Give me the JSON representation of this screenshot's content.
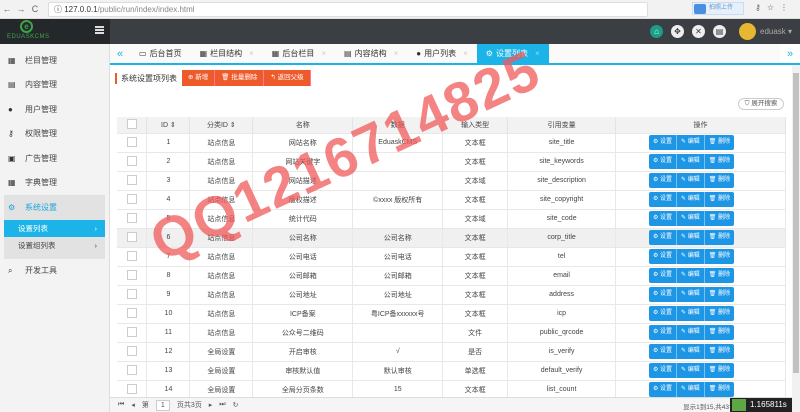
{
  "browser": {
    "url_host": "127.0.0.1",
    "url_path": "/public/run/index/index.html",
    "extension_label": "拍照上传"
  },
  "header": {
    "logo_text": "EDUASKCMS",
    "logo_mark": "e",
    "username": "eduask"
  },
  "sidebar": {
    "items": [
      {
        "label": "栏目管理",
        "icon": "▦"
      },
      {
        "label": "内容管理",
        "icon": "▤"
      },
      {
        "label": "用户管理",
        "icon": "●"
      },
      {
        "label": "权限管理",
        "icon": "⚷"
      },
      {
        "label": "广告管理",
        "icon": "▣"
      },
      {
        "label": "字典管理",
        "icon": "▦"
      }
    ],
    "group": {
      "label": "系统设置",
      "icon": "⚙",
      "subs": [
        {
          "label": "设置列表"
        },
        {
          "label": "设置组列表"
        }
      ]
    },
    "dev": {
      "label": "开发工具",
      "icon": "⌕"
    }
  },
  "tabs": [
    {
      "label": "后台首页",
      "icon": "▭"
    },
    {
      "label": "栏目结构",
      "icon": "▦"
    },
    {
      "label": "后台栏目",
      "icon": "▦"
    },
    {
      "label": "内容结构",
      "icon": "▤"
    },
    {
      "label": "用户列表",
      "icon": "●"
    },
    {
      "label": "设置列表",
      "icon": "⚙"
    }
  ],
  "toolbar": {
    "title": "系统设置项列表",
    "add": "新增",
    "batch_delete": "批量删除",
    "back": "返回父级",
    "search": "展开搜索"
  },
  "table": {
    "headers": [
      "ID",
      "分类ID",
      "名称",
      "数据",
      "输入类型",
      "引用变量",
      "操作"
    ],
    "rows": [
      [
        "1",
        "站点信息",
        "网站名称",
        "EduaskCMS",
        "文本框",
        "site_title"
      ],
      [
        "2",
        "站点信息",
        "网站关键字",
        "",
        "文本框",
        "site_keywords"
      ],
      [
        "3",
        "站点信息",
        "网站描述",
        "",
        "文本域",
        "site_description"
      ],
      [
        "4",
        "站点信息",
        "版权描述",
        "©xxxx 版权所有",
        "文本框",
        "site_copyright"
      ],
      [
        "5",
        "站点信息",
        "统计代码",
        "",
        "文本域",
        "site_code"
      ],
      [
        "6",
        "站点信息",
        "公司名称",
        "公司名称",
        "文本框",
        "corp_title"
      ],
      [
        "7",
        "站点信息",
        "公司电话",
        "公司电话",
        "文本框",
        "tel"
      ],
      [
        "8",
        "站点信息",
        "公司邮箱",
        "公司邮箱",
        "文本框",
        "email"
      ],
      [
        "9",
        "站点信息",
        "公司地址",
        "公司地址",
        "文本框",
        "address"
      ],
      [
        "10",
        "站点信息",
        "ICP备案",
        "粤ICP备xxxxxx号",
        "文本框",
        "icp"
      ],
      [
        "11",
        "站点信息",
        "公众号二维码",
        "",
        "文件",
        "public_qrcode"
      ],
      [
        "12",
        "全局设置",
        "开启审核",
        "√",
        "是否",
        "is_verify"
      ],
      [
        "13",
        "全局设置",
        "审核默认值",
        "默认审核",
        "单选框",
        "default_verify"
      ],
      [
        "14",
        "全局设置",
        "全局分页条数",
        "15",
        "文本框",
        "list_count"
      ]
    ],
    "actions": {
      "set": "设置",
      "edit": "编辑",
      "delete": "删除"
    }
  },
  "pagination": {
    "prefix": "第",
    "page": "1",
    "suffix": "页共3页",
    "info": "显示1到15,共43记录"
  },
  "timer": "1.165811s",
  "watermark": "QQ1216714825"
}
